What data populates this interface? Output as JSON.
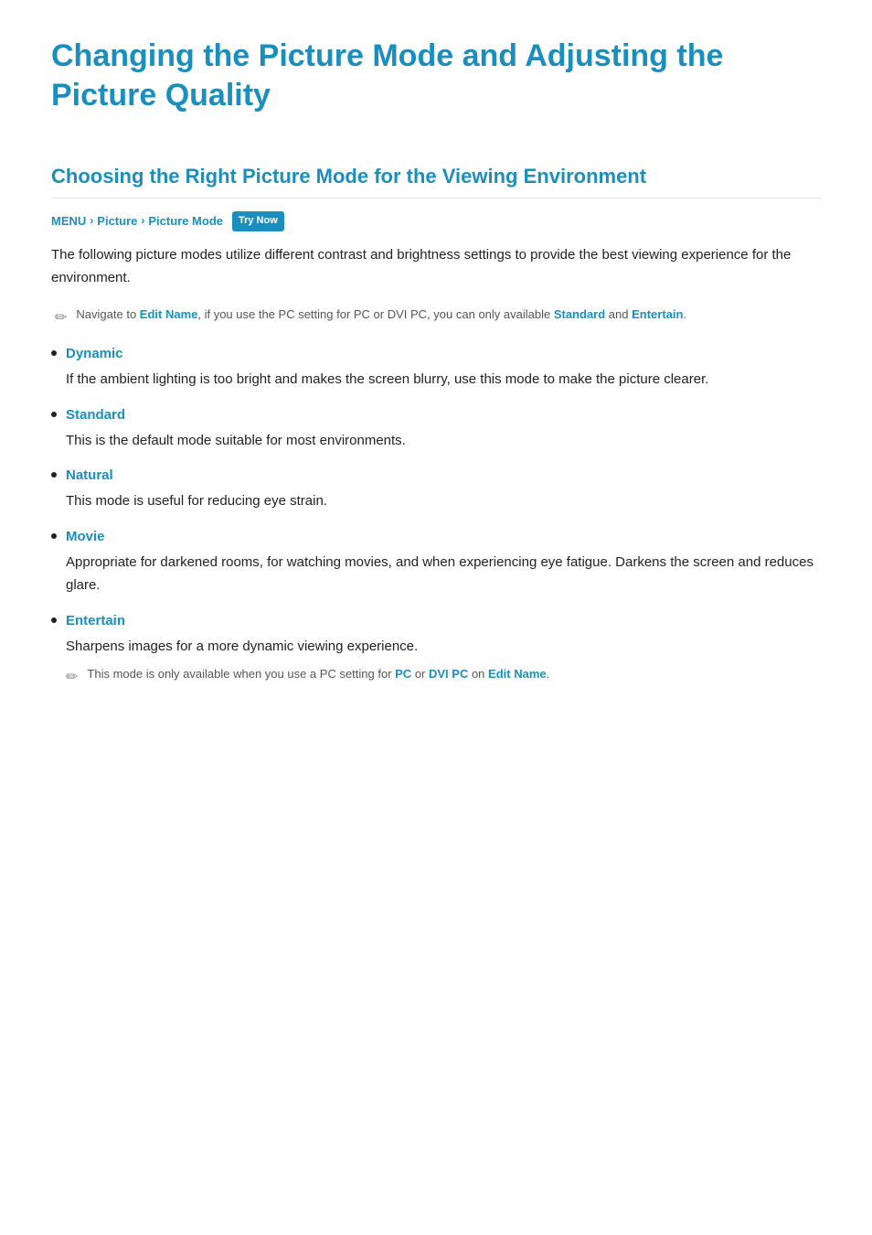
{
  "page": {
    "main_title": "Changing the Picture Mode and Adjusting the Picture Quality",
    "section": {
      "title": "Choosing the Right Picture Mode for the Viewing Environment",
      "breadcrumb": {
        "items": [
          "MENU",
          "Picture",
          "Picture Mode"
        ],
        "badge": "Try Now"
      },
      "intro": "The following picture modes utilize different contrast and brightness settings to provide the best viewing experience for the environment.",
      "note": {
        "text_before": "Navigate to ",
        "link1": "Edit Name",
        "text_middle": ", if you use the PC setting for PC or DVI PC, you can only available ",
        "link2": "Standard",
        "text_after": " and ",
        "link3": "Entertain",
        "text_end": "."
      },
      "modes": [
        {
          "term": "Dynamic",
          "description": "If the ambient lighting is too bright and makes the screen blurry, use this mode to make the picture clearer."
        },
        {
          "term": "Standard",
          "description": "This is the default mode suitable for most environments."
        },
        {
          "term": "Natural",
          "description": "This mode is useful for reducing eye strain."
        },
        {
          "term": "Movie",
          "description": "Appropriate for darkened rooms, for watching movies, and when experiencing eye fatigue. Darkens the screen and reduces glare."
        },
        {
          "term": "Entertain",
          "description": "Sharpens images for a more dynamic viewing experience.",
          "sub_note": {
            "text_before": "This mode is only available when you use a PC setting for ",
            "link1": "PC",
            "text_middle": " or ",
            "link2": "DVI PC",
            "text_after": " on ",
            "link3": "Edit Name",
            "text_end": "."
          }
        }
      ]
    }
  }
}
